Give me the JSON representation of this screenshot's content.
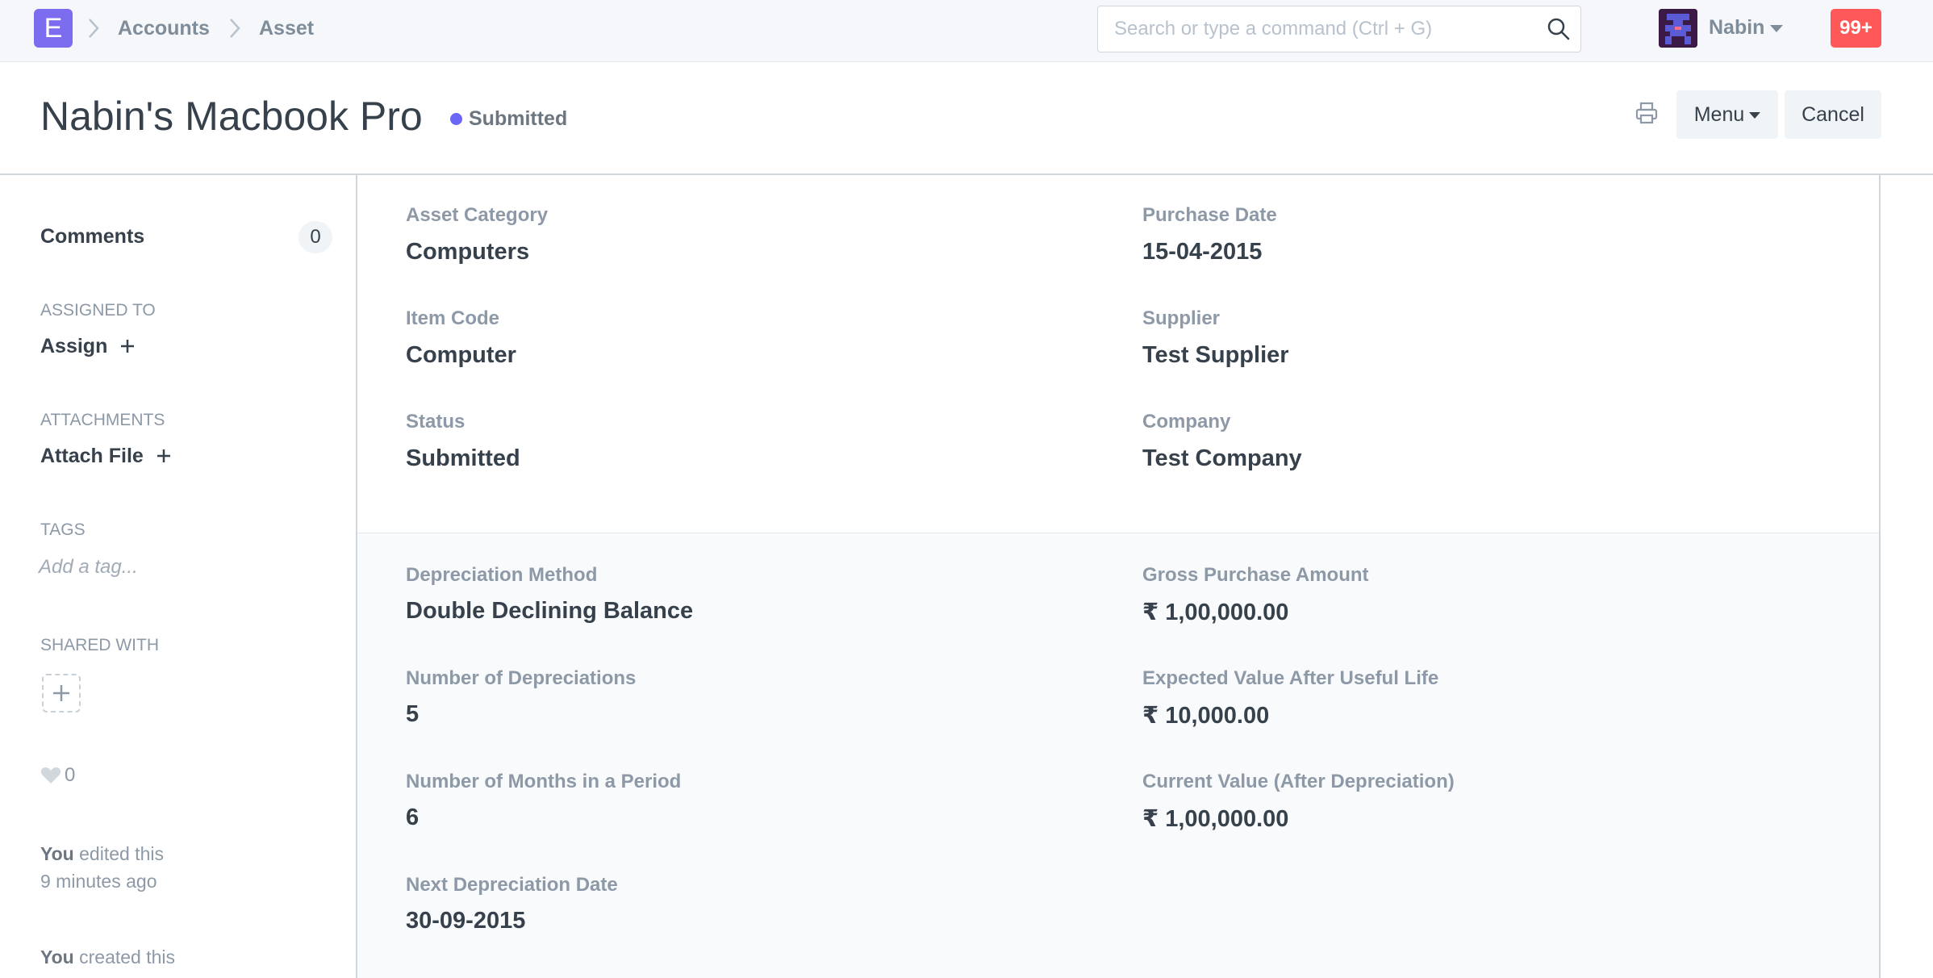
{
  "navbar": {
    "logo_letter": "E",
    "breadcrumbs": [
      "Accounts",
      "Asset"
    ],
    "search_placeholder": "Search or type a command (Ctrl + G)",
    "user_name": "Nabin",
    "notifications": "99+"
  },
  "page": {
    "title": "Nabin's Macbook Pro",
    "status": "Submitted",
    "status_color": "#6b66f5",
    "menu_label": "Menu",
    "cancel_label": "Cancel"
  },
  "sidebar": {
    "comments_label": "Comments",
    "comments_count": "0",
    "assigned_heading": "ASSIGNED TO",
    "assign_label": "Assign",
    "attachments_heading": "ATTACHMENTS",
    "attach_label": "Attach File",
    "tags_heading": "TAGS",
    "tag_placeholder": "Add a tag...",
    "shared_heading": "SHARED WITH",
    "likes": "0",
    "activity": [
      {
        "actor": "You",
        "action": " edited this",
        "time": "9 minutes ago"
      },
      {
        "actor": "You",
        "action": " created this"
      }
    ]
  },
  "form": {
    "section1": [
      {
        "label": "Asset Category",
        "value": "Computers"
      },
      {
        "label": "Purchase Date",
        "value": "15-04-2015"
      },
      {
        "label": "Item Code",
        "value": "Computer"
      },
      {
        "label": "Supplier",
        "value": "Test Supplier"
      },
      {
        "label": "Status",
        "value": "Submitted"
      },
      {
        "label": "Company",
        "value": "Test Company"
      }
    ],
    "section2": [
      {
        "label": "Depreciation Method",
        "value": "Double Declining Balance"
      },
      {
        "label": "Gross Purchase Amount",
        "value": "₹ 1,00,000.00"
      },
      {
        "label": "Number of Depreciations",
        "value": "5"
      },
      {
        "label": "Expected Value After Useful Life",
        "value": "₹ 10,000.00"
      },
      {
        "label": "Number of Months in a Period",
        "value": "6"
      },
      {
        "label": "Current Value (After Depreciation)",
        "value": "₹ 1,00,000.00"
      },
      {
        "label": "Next Depreciation Date",
        "value": "30-09-2015"
      }
    ]
  }
}
